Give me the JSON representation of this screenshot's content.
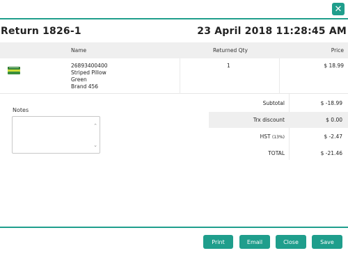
{
  "header": {
    "title": "Return  1826-1",
    "date": "23  April  2018  11:28:45  AM",
    "close_icon": "close-icon"
  },
  "table": {
    "headers": {
      "name": "Name",
      "returned_qty": "Returned  Qty",
      "price": "Price"
    },
    "rows": [
      {
        "thumbnail_icon": "product-thumbnail",
        "code": "26893400400",
        "name": "Striped Pillow",
        "color": "Green",
        "brand": "Brand  456",
        "qty": "1",
        "price": "$  18.99"
      }
    ]
  },
  "notes": {
    "label": "Notes",
    "value": "",
    "placeholder": ""
  },
  "summary": {
    "subtotal_label": "Subtotal",
    "subtotal_value": "$  -18.99",
    "discount_label": "Trx  discount",
    "discount_value": "$  0.00",
    "tax_label": "HST",
    "tax_rate": "(13%)",
    "tax_value": "$  -2.47",
    "total_label": "TOTAL",
    "total_value": "$  -21.46"
  },
  "footer": {
    "print_label": "Print",
    "email_label": "Email",
    "close_label": "Close",
    "save_label": "Save"
  },
  "colors": {
    "accent": "#1f9e8c",
    "header_band": "#efefef"
  }
}
